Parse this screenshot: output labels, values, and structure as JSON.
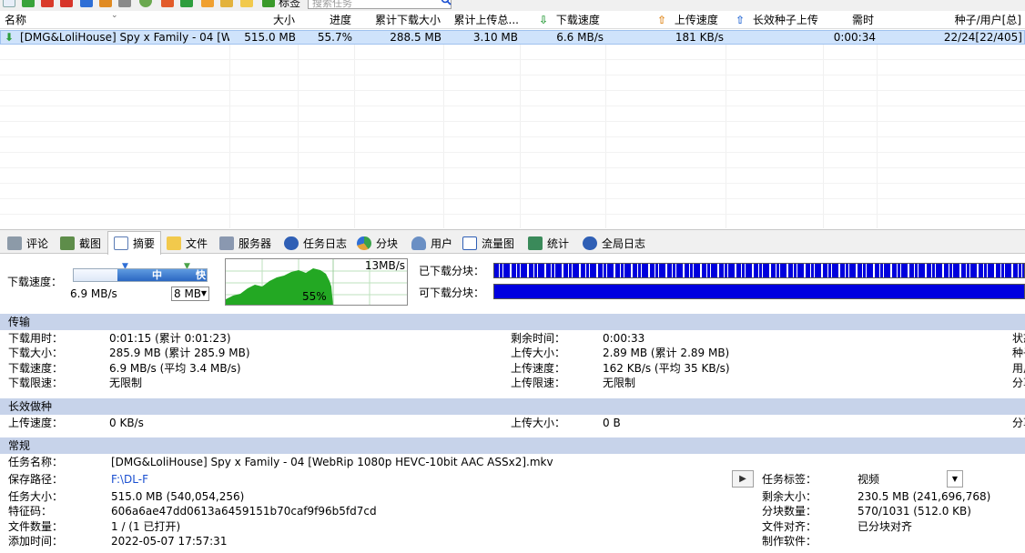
{
  "toolbar": {
    "tag_label": "标签",
    "search_placeholder": "搜索任务"
  },
  "columns": [
    "名称",
    "大小",
    "进度",
    "累计下载大小",
    "累计上传总...",
    "下载速度",
    "上传速度",
    "长效种子上传",
    "需时",
    "种子/用户[总]"
  ],
  "task": {
    "name": "[DMG&LoliHouse] Spy x Family - 04 [W...",
    "size": "515.0 MB",
    "progress": "55.7%",
    "downloaded": "288.5 MB",
    "uploaded": "3.10 MB",
    "down_speed": "6.6 MB/s",
    "up_speed": "181 KB/s",
    "seed_upload": "",
    "eta": "0:00:34",
    "peers": "22/24[22/405]"
  },
  "tabs": [
    "评论",
    "截图",
    "摘要",
    "文件",
    "服务器",
    "任务日志",
    "分块",
    "用户",
    "流量图",
    "统计",
    "全局日志"
  ],
  "active_tab": "摘要",
  "speed_panel": {
    "label": "下载速度：",
    "mid_label": "中",
    "fast_label": "快",
    "current_speed": "6.9 MB/s",
    "limit": "8 MB",
    "graph_max": "13MB/s",
    "graph_percent": "55%",
    "downloaded_pieces_label": "已下载分块：",
    "available_pieces_label": "可下载分块："
  },
  "transfer": {
    "title": "传输",
    "rows_left": [
      {
        "label": "下载用时：",
        "value": "0:01:15 (累计 0:01:23)"
      },
      {
        "label": "下载大小：",
        "value": "285.9 MB (累计 285.9 MB)"
      },
      {
        "label": "下载速度：",
        "value": "6.9 MB/s (平均 3.4 MB/s)"
      },
      {
        "label": "下载限速：",
        "value": "无限制"
      }
    ],
    "rows_right": [
      {
        "label": "剩余时间：",
        "value": "0:00:33"
      },
      {
        "label": "上传大小：",
        "value": "2.89 MB (累计 2.89 MB)"
      },
      {
        "label": "上传速度：",
        "value": "162 KB/s (平均 35 KB/s)"
      },
      {
        "label": "上传限速：",
        "value": "无限制"
      }
    ],
    "rows_edge": [
      "状态",
      "种子",
      "用户",
      "分享"
    ]
  },
  "seeding": {
    "title": "长效做种",
    "up_speed_label": "上传速度：",
    "up_speed_value": "0 KB/s",
    "up_size_label": "上传大小：",
    "up_size_value": "0 B",
    "edge": "分享"
  },
  "general": {
    "title": "常规",
    "task_name_label": "任务名称：",
    "task_name": "[DMG&LoliHouse] Spy x Family - 04 [WebRip 1080p HEVC-10bit AAC ASSx2].mkv",
    "save_path_label": "保存路径：",
    "save_path": "F:\\DL-F",
    "task_size_label": "任务大小：",
    "task_size": "515.0 MB (540,054,256)",
    "hash_label": "特征码：",
    "hash": "606a6ae47dd0613a6459151b70caf9f96b5fd7cd",
    "file_count_label": "文件数量：",
    "file_count": "1 / (1 已打开)",
    "added_label": "添加时间：",
    "added": "2022-05-07 17:57:31",
    "tag_label": "任务标签：",
    "tag": "视频",
    "remaining_label": "剩余大小：",
    "remaining": "230.5 MB (241,696,768)",
    "pieces_label": "分块数量：",
    "pieces": "570/1031 (512.0 KB)",
    "align_label": "文件对齐：",
    "align": "已分块对齐",
    "software_label": "制作软件：",
    "software": ""
  }
}
